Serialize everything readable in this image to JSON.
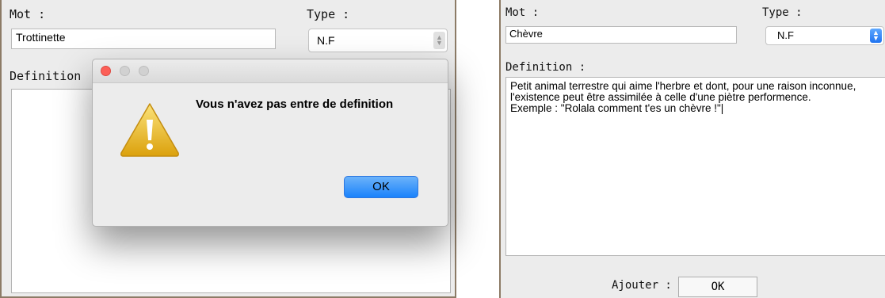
{
  "left_form": {
    "mot_label": "Mot :",
    "mot_value": "Trottinette",
    "type_label": "Type :",
    "type_value": "N.F",
    "definition_label": "Definition",
    "definition_value": ""
  },
  "alert": {
    "message": "Vous n'avez pas entre de definition",
    "ok_label": "OK",
    "icon": "warning-icon"
  },
  "right_form": {
    "mot_label": "Mot :",
    "mot_value": "Chèvre",
    "type_label": "Type :",
    "type_value": "N.F",
    "definition_label": "Definition :",
    "definition_value": "Petit animal terrestre qui aime l'herbre et dont, pour une raison inconnue,\nl'existence peut être assimilée à celle d'une piètre performence.\nExemple : \"Rolala comment t'es un chèvre !\"|",
    "add_label": "Ajouter :",
    "add_button": "OK"
  },
  "colors": {
    "panel_border": "#8c7b66",
    "accent_blue": "#1a82fb",
    "close_red": "#fc5f57",
    "warning_yellow": "#f2c01d"
  }
}
